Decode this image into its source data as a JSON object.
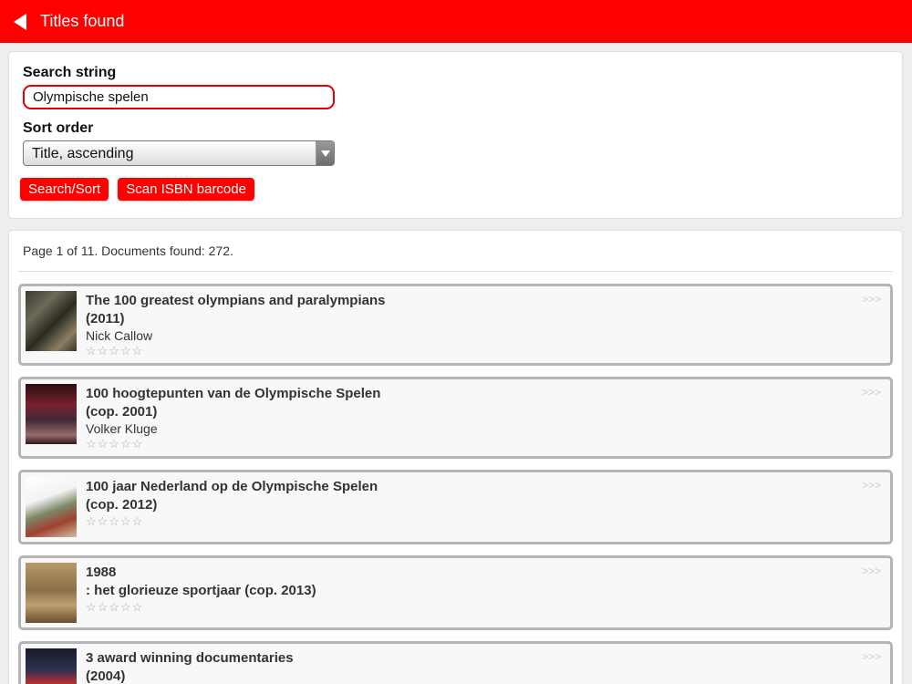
{
  "header": {
    "title": "Titles found",
    "accent_color": "#fe0000"
  },
  "search": {
    "label": "Search string",
    "value": "Olympische spelen",
    "sort_label": "Sort order",
    "sort_value": "Title, ascending",
    "search_button": "Search/Sort",
    "scan_button": "Scan ISBN barcode"
  },
  "results": {
    "page_info": "Page 1 of 11. Documents found: 272.",
    "more_label": ">>>",
    "stars": "☆☆☆☆☆",
    "items": [
      {
        "title1": "The 100 greatest olympians and paralympians",
        "title2": "(2011)",
        "author": "Nick Callow",
        "thumb_icon": "book-cover-photo"
      },
      {
        "title1": "100 hoogtepunten van de Olympische Spelen",
        "title2": "(cop. 2001)",
        "author": "Volker Kluge",
        "thumb_icon": "book-cover-photo"
      },
      {
        "title1": "100 jaar Nederland op de Olympische Spelen",
        "title2": "(cop. 2012)",
        "author": "",
        "thumb_icon": "book-cover-photo"
      },
      {
        "title1": "1988",
        "title2": ": het glorieuze sportjaar (cop. 2013)",
        "author": "",
        "thumb_icon": "book-cover-photo"
      },
      {
        "title1": "3 award winning documentaries",
        "title2": "(2004)",
        "author": "",
        "thumb_icon": "dvd-cover-photo"
      }
    ]
  }
}
